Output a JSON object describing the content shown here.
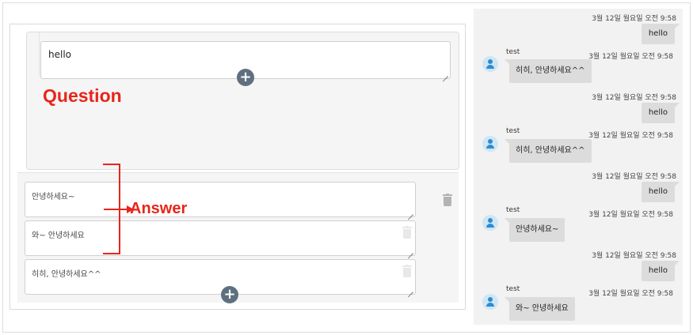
{
  "editor": {
    "question_value": "hello",
    "question_annotation": "Question",
    "answers": [
      "안녕하세요~",
      "와~ 안녕하세요",
      "히히, 안녕하세요^^"
    ],
    "answer_annotation": "Answer",
    "annotation_color": "#e8251b",
    "add_button_color": "#5e7080",
    "add_symbol": "+"
  },
  "chat": {
    "messages": [
      {
        "direction": "out",
        "time": "3월 12일 월요일 오전 9:58",
        "text": "hello"
      },
      {
        "direction": "in",
        "sender": "test",
        "time": "3월 12일 월요일 오전 9:58",
        "text": "히히, 안녕하세요^^"
      },
      {
        "direction": "out",
        "time": "3월 12일 월요일 오전 9:58",
        "text": "hello"
      },
      {
        "direction": "in",
        "sender": "test",
        "time": "3월 12일 월요일 오전 9:58",
        "text": "히히, 안녕하세요^^"
      },
      {
        "direction": "out",
        "time": "3월 12일 월요일 오전 9:58",
        "text": "hello"
      },
      {
        "direction": "in",
        "sender": "test",
        "time": "3월 12일 월요일 오전 9:58",
        "text": "안녕하세요~"
      },
      {
        "direction": "out",
        "time": "3월 12일 월요일 오전 9:58",
        "text": "hello"
      },
      {
        "direction": "in",
        "sender": "test",
        "time": "3월 12일 월요일 오전 9:58",
        "text": "와~ 안녕하세요"
      }
    ]
  }
}
